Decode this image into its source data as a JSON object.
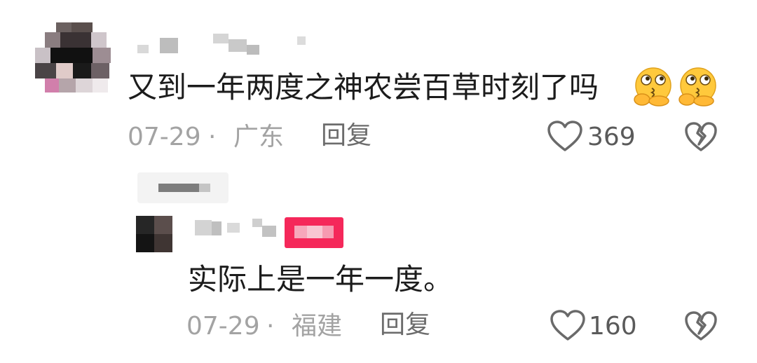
{
  "comment": {
    "text": "又到一年两度之神农尝百草时刻了吗",
    "emojis": [
      "thinking-kiss-emoji",
      "thinking-kiss-emoji"
    ],
    "date": "07-29",
    "sep": "·",
    "location": "广东",
    "reply_label": "回复",
    "likes": "369",
    "icons": {
      "like": "heart-outline-icon",
      "dislike": "broken-heart-icon"
    }
  },
  "reply": {
    "text": "实际上是一年一度。",
    "date": "07-29",
    "sep": "·",
    "location": "福建",
    "reply_label": "回复",
    "likes": "160",
    "badge_color": "#f5285a",
    "icons": {
      "like": "heart-outline-icon",
      "dislike": "broken-heart-icon"
    }
  }
}
